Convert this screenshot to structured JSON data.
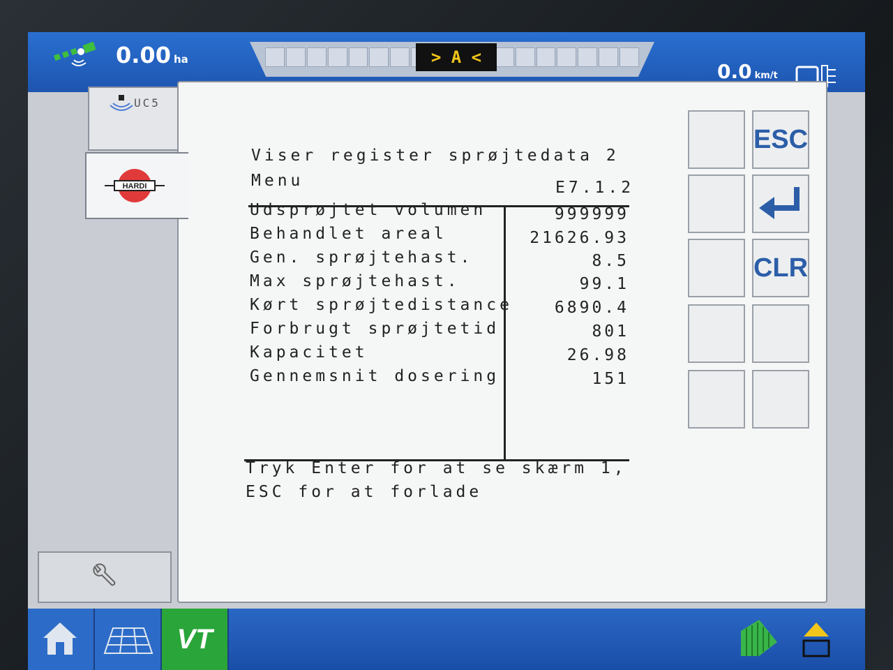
{
  "status_bar": {
    "area_value": "0.00",
    "area_unit": "ha",
    "lightbar_indicator": "> A <",
    "speed_value": "0.0",
    "speed_unit": "km/t"
  },
  "left_panel": {
    "uc5_label": "UC5",
    "hardi_logo_text": "HARDI"
  },
  "main": {
    "title": "Viser register sprøjtedata 2",
    "menu_label": "Menu",
    "menu_code": "E7.1.2",
    "rows": [
      {
        "label": "Udsprøjtet volumen",
        "value": "999999"
      },
      {
        "label": "Behandlet areal",
        "value": "21626.93"
      },
      {
        "label": "Gen. sprøjtehast.",
        "value": "8.5"
      },
      {
        "label": "Max sprøjtehast.",
        "value": "99.1"
      },
      {
        "label": "Kørt sprøjtedistance",
        "value": "6890.4"
      },
      {
        "label": "Forbrugt sprøjtetid",
        "value": "801"
      },
      {
        "label": "Kapacitet",
        "value": "26.98"
      },
      {
        "label": "Gennemsnit dosering",
        "value": "151"
      }
    ],
    "footer_line1": "Tryk Enter for at se skærm 1,",
    "footer_line2": "ESC for at forlade"
  },
  "softkeys": {
    "esc_label": "ESC",
    "clr_label": "CLR"
  },
  "bottom_bar": {
    "vt_label": "VT"
  },
  "colors": {
    "bar_blue": "#1d55b0",
    "vt_green": "#2aa53a",
    "softkey_text": "#2c5ea8",
    "lightbar_text": "#f2c61a"
  }
}
